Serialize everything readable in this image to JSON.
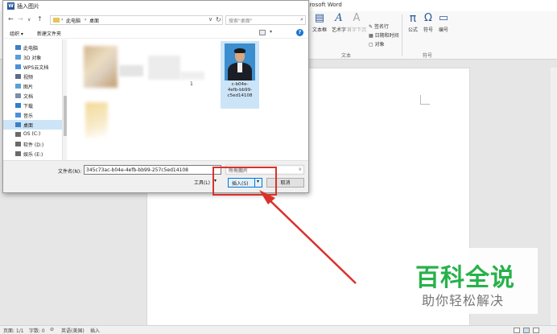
{
  "word": {
    "title": "rcrosoft Word",
    "ribbon": {
      "text_box": "文本框",
      "wordart": "艺术字",
      "dropcap": "首字下沉",
      "signature": "签名行",
      "datetime": "日期和时间",
      "object": "对象",
      "equation": "公式",
      "symbol": "符号",
      "number": "编号",
      "group_text": "文本",
      "group_symbols": "符号",
      "equation_icon": "π",
      "symbol_icon": "Ω"
    },
    "status": {
      "page": "页面: 1/1",
      "words": "字数: 0",
      "language": "英语(美国)",
      "mode": "插入"
    }
  },
  "dialog": {
    "title": "插入图片",
    "address": {
      "crumb1": "此电脑",
      "crumb2": "桌面"
    },
    "search_placeholder": "搜索\"桌面\"",
    "toolbar": {
      "organize": "组织 ▾",
      "new_folder": "新建文件夹"
    },
    "nav_items": [
      {
        "label": "此电脑",
        "color": "#3c7fc4"
      },
      {
        "label": "3D 对象",
        "color": "#5aa0d8"
      },
      {
        "label": "WPS云文档",
        "color": "#4a90d9"
      },
      {
        "label": "视频",
        "color": "#5b6b8a"
      },
      {
        "label": "图片",
        "color": "#5aa0d8"
      },
      {
        "label": "文档",
        "color": "#7d8da6"
      },
      {
        "label": "下载",
        "color": "#2f7fcf"
      },
      {
        "label": "音乐",
        "color": "#4a90d9"
      },
      {
        "label": "桌面",
        "color": "#3c7fc4"
      },
      {
        "label": "OS (C:)",
        "color": "#6a6a6a"
      },
      {
        "label": "软件 (D:)",
        "color": "#6a6a6a"
      },
      {
        "label": "娱乐 (E:)",
        "color": "#6a6a6a"
      }
    ],
    "file": {
      "label_line1": "c-b04e-",
      "label_line2": "4efb-bb99-",
      "label_line3": "c5ed14108",
      "stray": "1"
    },
    "filename_label": "文件名(N):",
    "filename_value": "345c73ac-b04e-4efb-bb99-257c5ed14108",
    "type_value": "所有图片",
    "tools_label": "工具(L)",
    "insert_label": "插入(S)",
    "cancel_label": "取消"
  },
  "watermark": {
    "main": "百科全说",
    "sub": "助你轻松解决"
  },
  "colors": {
    "highlight": "#d9322b",
    "watermark_green": "#27b24a"
  }
}
